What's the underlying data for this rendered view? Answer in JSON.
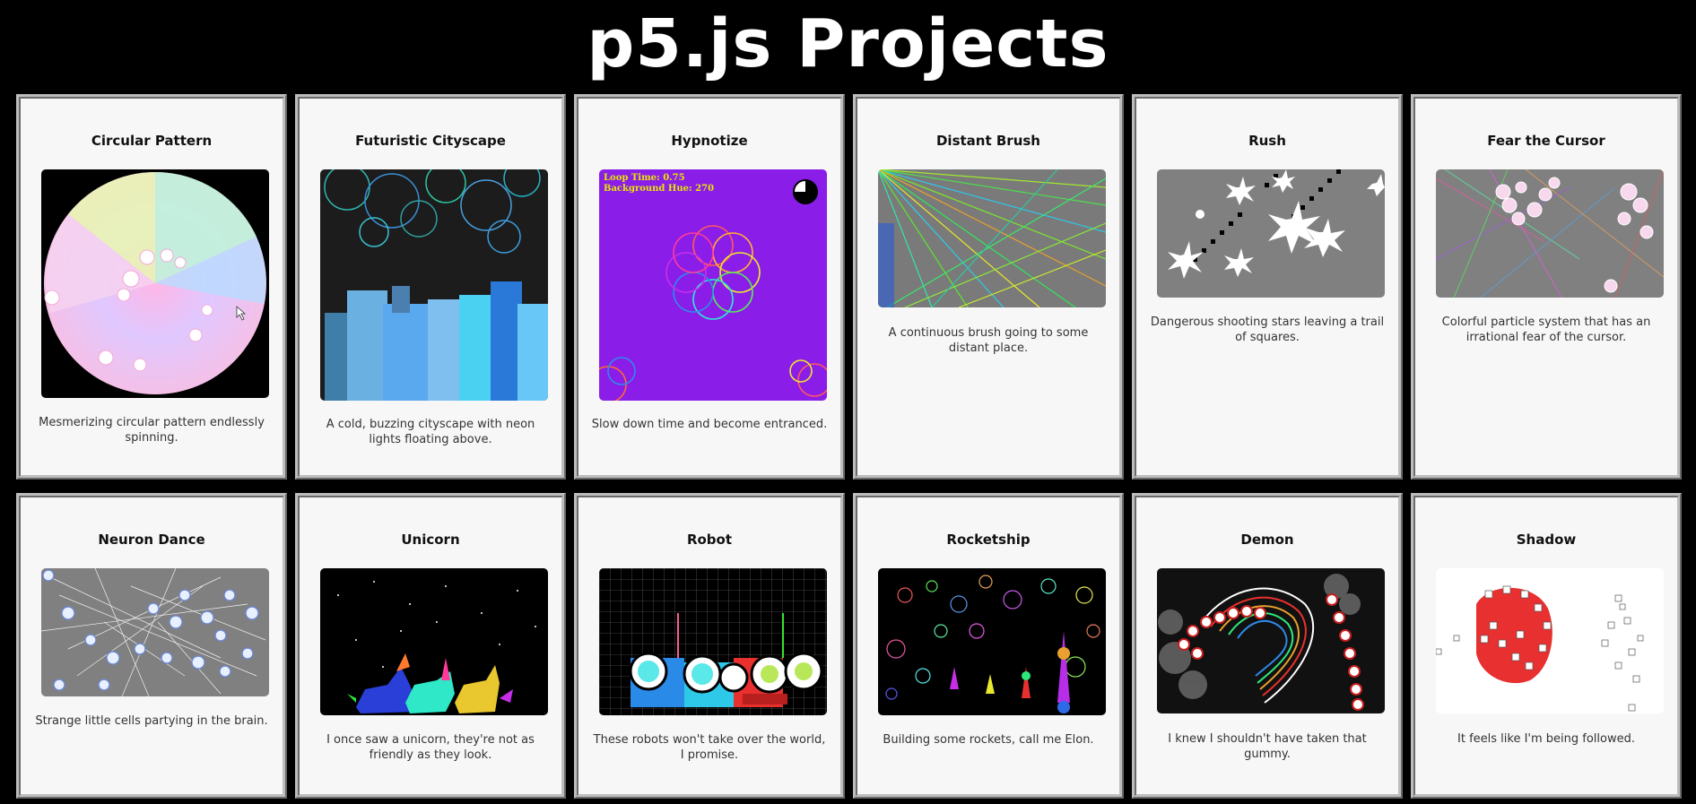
{
  "page": {
    "title": "p5.js Projects"
  },
  "projects": [
    {
      "title": "Circular Pattern",
      "description": "Mesmerizing circular pattern endlessly spinning."
    },
    {
      "title": "Futuristic Cityscape",
      "description": "A cold, buzzing cityscape with neon lights floating above."
    },
    {
      "title": "Hypnotize",
      "description": "Slow down time and become entranced.",
      "overlay_line_1": "Loop Time: 0.75",
      "overlay_line_2": "Background Hue: 270"
    },
    {
      "title": "Distant Brush",
      "description": "A continuous brush going to some distant place."
    },
    {
      "title": "Rush",
      "description": "Dangerous shooting stars leaving a trail of squares."
    },
    {
      "title": "Fear the Cursor",
      "description": "Colorful particle system that has an irrational fear of the cursor."
    },
    {
      "title": "Neuron Dance",
      "description": "Strange little cells partying in the brain."
    },
    {
      "title": "Unicorn",
      "description": "I once saw a unicorn, they're not as friendly as they look."
    },
    {
      "title": "Robot",
      "description": "These robots won't take over the world, I promise."
    },
    {
      "title": "Rocketship",
      "description": "Building some rockets, call me Elon."
    },
    {
      "title": "Demon",
      "description": "I knew I shouldn't have taken that gummy."
    },
    {
      "title": "Shadow",
      "description": "It feels like I'm being followed."
    }
  ]
}
